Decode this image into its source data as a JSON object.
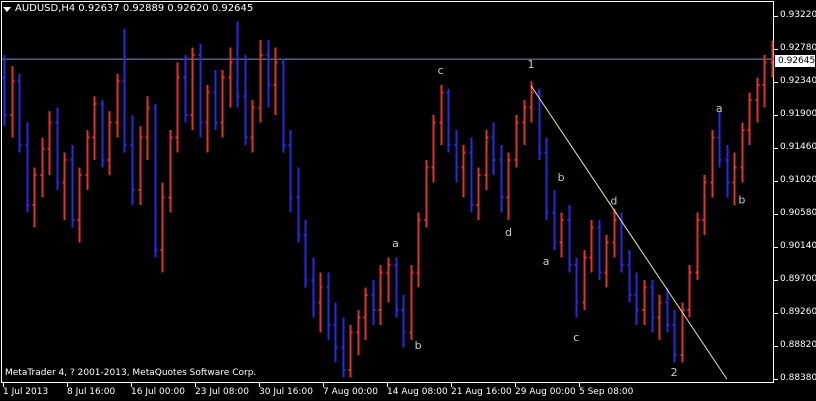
{
  "header": {
    "symbol": "AUDUSD,H4",
    "values": "0.92637 0.92889 0.92620 0.92645"
  },
  "copyright": "MetaTrader 4, ? 2001-2013, MetaQuotes Software Corp.",
  "current_price": "0.92645",
  "colors": {
    "background": "#000000",
    "bull": "#e03232",
    "bear": "#2a2ae0",
    "trendline": "#f0e0b0",
    "price_line": "#7f8fc0"
  },
  "chart_data": {
    "type": "ohlc",
    "y_ticks": [
      "0.93220",
      "0.92780",
      "0.92340",
      "0.91900",
      "0.91460",
      "0.91020",
      "0.90580",
      "0.90140",
      "0.89700",
      "0.89260",
      "0.88820",
      "0.88380"
    ],
    "x_ticks": [
      "1 Jul 2013",
      "8 Jul 16:00",
      "16 Jul 00:00",
      "23 Jul 08:00",
      "30 Jul 16:00",
      "7 Aug 00:00",
      "14 Aug 08:00",
      "21 Aug 16:00",
      "29 Aug 00:00",
      "5 Sep 08:00"
    ],
    "ylim": [
      0.8838,
      0.9322
    ],
    "wave_labels": [
      {
        "text": "c",
        "bar": 58,
        "price": 0.9245
      },
      {
        "text": "1",
        "bar": 70,
        "price": 0.9253
      },
      {
        "text": "b",
        "bar": 74,
        "price": 0.9102
      },
      {
        "text": "d",
        "bar": 67,
        "price": 0.9029
      },
      {
        "text": "d",
        "bar": 81,
        "price": 0.9071
      },
      {
        "text": "a",
        "bar": 52,
        "price": 0.9014
      },
      {
        "text": "a",
        "bar": 72,
        "price": 0.899
      },
      {
        "text": "b",
        "bar": 55,
        "price": 0.8878
      },
      {
        "text": "c",
        "bar": 76,
        "price": 0.8889
      },
      {
        "text": "2",
        "bar": 89,
        "price": 0.8842
      },
      {
        "text": "a",
        "bar": 95,
        "price": 0.9194
      },
      {
        "text": "b",
        "bar": 98,
        "price": 0.9072
      }
    ],
    "trendline": {
      "from": {
        "bar": 70,
        "price": 0.9229
      },
      "to": {
        "bar": 96,
        "price": 0.8838
      }
    },
    "ohlc": [
      [
        0.924,
        0.927,
        0.9175,
        0.919
      ],
      [
        0.919,
        0.9255,
        0.916,
        0.9235
      ],
      [
        0.9235,
        0.9245,
        0.914,
        0.915
      ],
      [
        0.915,
        0.918,
        0.906,
        0.907
      ],
      [
        0.907,
        0.912,
        0.904,
        0.911
      ],
      [
        0.911,
        0.916,
        0.908,
        0.9145
      ],
      [
        0.9145,
        0.9195,
        0.911,
        0.918
      ],
      [
        0.918,
        0.92,
        0.909,
        0.91
      ],
      [
        0.91,
        0.914,
        0.905,
        0.913
      ],
      [
        0.913,
        0.915,
        0.904,
        0.905
      ],
      [
        0.905,
        0.912,
        0.902,
        0.911
      ],
      [
        0.911,
        0.917,
        0.909,
        0.916
      ],
      [
        0.916,
        0.9215,
        0.913,
        0.9205
      ],
      [
        0.9205,
        0.921,
        0.912,
        0.913
      ],
      [
        0.913,
        0.9195,
        0.911,
        0.918
      ],
      [
        0.918,
        0.9245,
        0.916,
        0.9235
      ],
      [
        0.9235,
        0.9305,
        0.914,
        0.915
      ],
      [
        0.915,
        0.919,
        0.907,
        0.909
      ],
      [
        0.909,
        0.9175,
        0.907,
        0.916
      ],
      [
        0.916,
        0.9215,
        0.913,
        0.92
      ],
      [
        0.92,
        0.9205,
        0.9,
        0.901
      ],
      [
        0.901,
        0.91,
        0.898,
        0.908
      ],
      [
        0.908,
        0.917,
        0.906,
        0.916
      ],
      [
        0.916,
        0.926,
        0.914,
        0.924
      ],
      [
        0.924,
        0.927,
        0.918,
        0.919
      ],
      [
        0.919,
        0.928,
        0.917,
        0.927
      ],
      [
        0.927,
        0.9285,
        0.916,
        0.918
      ],
      [
        0.918,
        0.923,
        0.914,
        0.922
      ],
      [
        0.922,
        0.925,
        0.917,
        0.918
      ],
      [
        0.918,
        0.925,
        0.916,
        0.924
      ],
      [
        0.924,
        0.928,
        0.92,
        0.926
      ],
      [
        0.926,
        0.9315,
        0.92,
        0.9215
      ],
      [
        0.9215,
        0.927,
        0.915,
        0.916
      ],
      [
        0.916,
        0.921,
        0.914,
        0.92
      ],
      [
        0.92,
        0.929,
        0.918,
        0.927
      ],
      [
        0.927,
        0.929,
        0.92,
        0.923
      ],
      [
        0.923,
        0.928,
        0.919,
        0.926
      ],
      [
        0.926,
        0.9265,
        0.914,
        0.915
      ],
      [
        0.915,
        0.917,
        0.906,
        0.908
      ],
      [
        0.908,
        0.912,
        0.902,
        0.903
      ],
      [
        0.903,
        0.905,
        0.896,
        0.897
      ],
      [
        0.897,
        0.9,
        0.892,
        0.894
      ],
      [
        0.894,
        0.898,
        0.89,
        0.896
      ],
      [
        0.896,
        0.898,
        0.889,
        0.891
      ],
      [
        0.891,
        0.894,
        0.886,
        0.888
      ],
      [
        0.888,
        0.892,
        0.884,
        0.885
      ],
      [
        0.885,
        0.891,
        0.884,
        0.89
      ],
      [
        0.89,
        0.893,
        0.887,
        0.892
      ],
      [
        0.892,
        0.896,
        0.889,
        0.895
      ],
      [
        0.895,
        0.897,
        0.891,
        0.893
      ],
      [
        0.893,
        0.899,
        0.891,
        0.898
      ],
      [
        0.898,
        0.9,
        0.894,
        0.899
      ],
      [
        0.899,
        0.9,
        0.892,
        0.893
      ],
      [
        0.893,
        0.895,
        0.888,
        0.89
      ],
      [
        0.89,
        0.899,
        0.889,
        0.898
      ],
      [
        0.898,
        0.906,
        0.896,
        0.905
      ],
      [
        0.905,
        0.913,
        0.904,
        0.912
      ],
      [
        0.912,
        0.919,
        0.91,
        0.918
      ],
      [
        0.918,
        0.923,
        0.915,
        0.922
      ],
      [
        0.922,
        0.9225,
        0.914,
        0.915
      ],
      [
        0.915,
        0.917,
        0.91,
        0.912
      ],
      [
        0.912,
        0.915,
        0.908,
        0.914
      ],
      [
        0.914,
        0.916,
        0.906,
        0.907
      ],
      [
        0.907,
        0.912,
        0.905,
        0.911
      ],
      [
        0.911,
        0.917,
        0.909,
        0.916
      ],
      [
        0.916,
        0.918,
        0.911,
        0.913
      ],
      [
        0.913,
        0.915,
        0.906,
        0.908
      ],
      [
        0.908,
        0.914,
        0.905,
        0.913
      ],
      [
        0.913,
        0.919,
        0.912,
        0.918
      ],
      [
        0.918,
        0.921,
        0.915,
        0.92
      ],
      [
        0.92,
        0.9235,
        0.918,
        0.922
      ],
      [
        0.922,
        0.9225,
        0.913,
        0.914
      ],
      [
        0.914,
        0.916,
        0.905,
        0.906
      ],
      [
        0.906,
        0.909,
        0.901,
        0.902
      ],
      [
        0.902,
        0.906,
        0.9,
        0.905
      ],
      [
        0.905,
        0.907,
        0.898,
        0.899
      ],
      [
        0.899,
        0.9,
        0.892,
        0.894
      ],
      [
        0.894,
        0.901,
        0.893,
        0.9
      ],
      [
        0.9,
        0.905,
        0.898,
        0.904
      ],
      [
        0.904,
        0.905,
        0.897,
        0.898
      ],
      [
        0.898,
        0.903,
        0.896,
        0.902
      ],
      [
        0.902,
        0.9065,
        0.9,
        0.905
      ],
      [
        0.905,
        0.906,
        0.898,
        0.899
      ],
      [
        0.899,
        0.901,
        0.894,
        0.895
      ],
      [
        0.895,
        0.898,
        0.891,
        0.893
      ],
      [
        0.893,
        0.897,
        0.891,
        0.896
      ],
      [
        0.896,
        0.897,
        0.89,
        0.892
      ],
      [
        0.892,
        0.895,
        0.889,
        0.894
      ],
      [
        0.894,
        0.896,
        0.89,
        0.891
      ],
      [
        0.891,
        0.893,
        0.886,
        0.887
      ],
      [
        0.887,
        0.894,
        0.886,
        0.893
      ],
      [
        0.893,
        0.899,
        0.892,
        0.898
      ],
      [
        0.898,
        0.906,
        0.897,
        0.905
      ],
      [
        0.905,
        0.911,
        0.903,
        0.91
      ],
      [
        0.91,
        0.917,
        0.908,
        0.916
      ],
      [
        0.916,
        0.9195,
        0.912,
        0.913
      ],
      [
        0.913,
        0.915,
        0.908,
        0.91
      ],
      [
        0.91,
        0.914,
        0.907,
        0.912
      ],
      [
        0.912,
        0.918,
        0.91,
        0.917
      ],
      [
        0.917,
        0.922,
        0.915,
        0.921
      ],
      [
        0.921,
        0.924,
        0.918,
        0.923
      ],
      [
        0.923,
        0.927,
        0.92,
        0.926
      ],
      [
        0.926,
        0.9289,
        0.924,
        0.9265
      ]
    ]
  }
}
